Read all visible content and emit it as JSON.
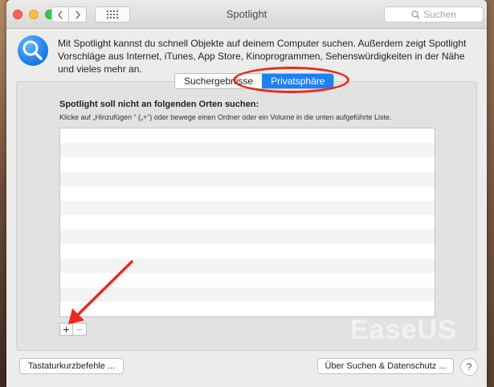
{
  "window": {
    "title": "Spotlight",
    "search_placeholder": "Suchen"
  },
  "intro": {
    "text": "Mit Spotlight kannst du schnell Objekte auf deinem Computer suchen. Außerdem zeigt Spotlight Vorschläge aus Internet, iTunes, App Store, Kinoprogrammen, Sehenswürdigkeiten in der Nähe und vieles mehr an."
  },
  "tabs": [
    {
      "label": "Suchergebnisse",
      "active": false
    },
    {
      "label": "Privatsphäre",
      "active": true
    }
  ],
  "privacy": {
    "heading": "Spotlight soll nicht an folgenden Orten suchen:",
    "hint": "Klicke auf „Hinzufügen “ („+“) oder bewege einen Ordner oder ein Volume in die unten aufgeführte Liste.",
    "add_label": "+",
    "remove_label": "−"
  },
  "buttons": {
    "keyboard_shortcuts": "Tastaturkurzbefehle ...",
    "about_privacy": "Über Suchen & Datenschutz ...",
    "help": "?"
  },
  "watermark": "EaseUS",
  "colors": {
    "accent": "#1e80f4",
    "annotation": "#e82a1c"
  },
  "icons": {
    "header": "spotlight-magnifier-icon",
    "search": "magnifier-icon"
  }
}
